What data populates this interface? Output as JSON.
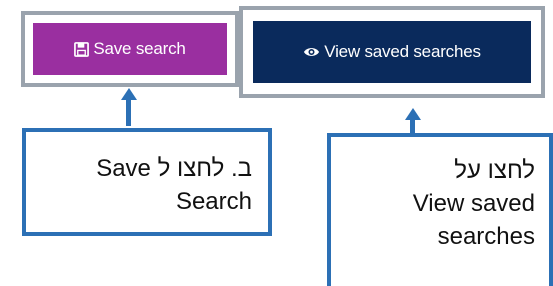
{
  "buttons": {
    "save": {
      "label": "Save search",
      "icon": "floppy-disk-icon",
      "bg_color": "#9a2fa0"
    },
    "view": {
      "label": "View saved searches",
      "icon": "eye-icon",
      "bg_color": "#0a2a5c"
    }
  },
  "callouts": {
    "save": {
      "line1_hebrew": "ב. לחצו ל",
      "line1_english": "Save",
      "line2": "Search"
    },
    "view": {
      "line1": "לחצו על",
      "line2": "View saved",
      "line3": "searches"
    }
  },
  "colors": {
    "frame_border": "#9aa3ad",
    "callout_border": "#2c70b5",
    "arrow": "#2c70b5"
  }
}
